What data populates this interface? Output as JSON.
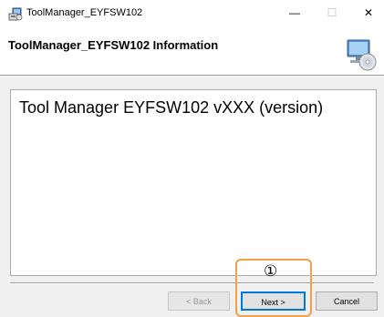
{
  "window": {
    "title": "ToolManager_EYFSW102",
    "controls": {
      "minimize": "—",
      "maximize": "☐",
      "close": "✕"
    }
  },
  "header": {
    "title": "ToolManager_EYFSW102 Information",
    "graphic_icon": "computer-cd-icon"
  },
  "content": {
    "product_name": "Tool Manager EYFSW102 vXXX",
    "version_placeholder": "(version)"
  },
  "buttons": {
    "back": "< Back",
    "next": "Next >",
    "cancel": "Cancel"
  },
  "annotation": {
    "marker": "①",
    "color": "#f0a04b"
  },
  "colors": {
    "focus_border": "#0078d7"
  }
}
